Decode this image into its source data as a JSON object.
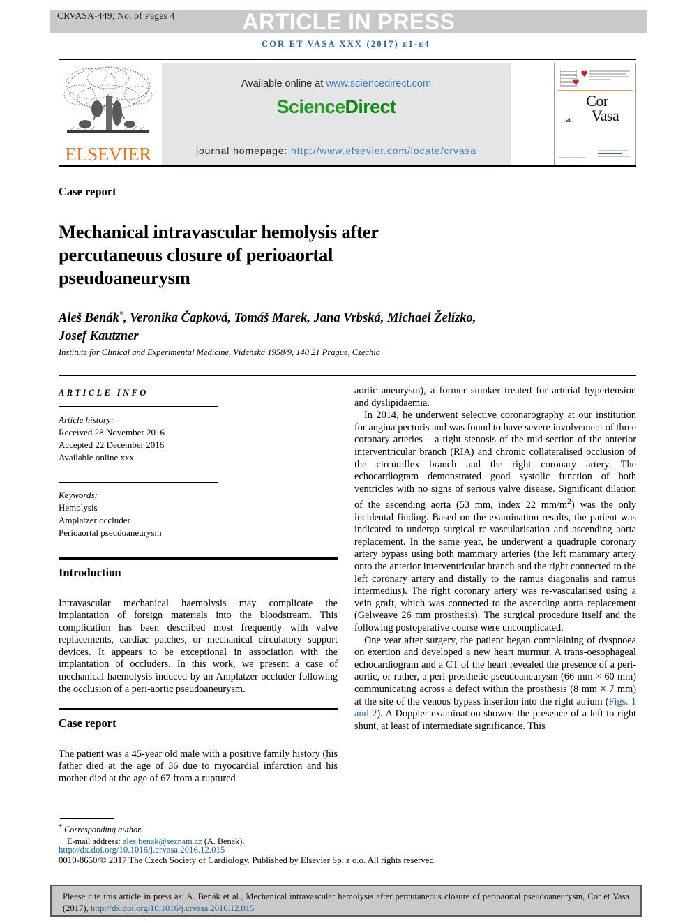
{
  "header": {
    "article_id": "CRVASA-449; No. of Pages 4",
    "article_in_press": "ARTICLE IN PRESS",
    "running_head": "COR ET VASA XXX (2017) e1-e4"
  },
  "masthead": {
    "publisher_name": "ELSEVIER",
    "available_prefix": "Available online at ",
    "available_url": "www.sciencedirect.com",
    "sciencedirect_part1": "Science",
    "sciencedirect_part2": "Direct",
    "homepage_label": "journal homepage: ",
    "homepage_url": "http://www.elsevier.com/locate/crvasa",
    "cover_title_cor": "Cor",
    "cover_title_et": "et",
    "cover_title_vasa": "Vasa"
  },
  "article": {
    "section_label": "Case report",
    "title": "Mechanical intravascular hemolysis after percutaneous closure of perioaortal pseudoaneurysm",
    "authors_line1": "Aleš Benák",
    "authors_line1_rest": ", Veronika Čapková, Tomáš Marek, Jana Vrbská,",
    "authors_line2": "Michael Želízko, Josef Kautzner",
    "corresponding_marker": "*",
    "affiliation": "Institute for Clinical and Experimental Medicine, Vídeňská 1958/9, 140 21 Prague, Czechia"
  },
  "article_info": {
    "heading": "ARTICLE INFO",
    "history_label": "Article history:",
    "received": "Received 28 November 2016",
    "accepted": "Accepted 22 December 2016",
    "available_online": "Available online xxx",
    "keywords_label": "Keywords:",
    "keywords": [
      "Hemolysis",
      "Amplatzer occluder",
      "Perioaortal pseudoaneurysm"
    ]
  },
  "sections": {
    "introduction_heading": "Introduction",
    "introduction_text": "Intravascular mechanical haemolysis may complicate the implantation of foreign materials into the bloodstream. This complication has been described most frequently with valve replacements, cardiac patches, or mechanical circulatory support devices. It appears to be exceptional in association with the implantation of occluders. In this work, we present a case of mechanical haemolysis induced by an Amplatzer occluder following the occlusion of a peri-aortic pseudoaneurysm.",
    "case_report_heading": "Case report",
    "case_report_text": "The patient was a 45-year old male with a positive family history (his father died at the age of 36 due to myocardial infarction and his mother died at the age of 67 from a ruptured"
  },
  "right_column": {
    "para1_continued": "aortic aneurysm), a former smoker treated for arterial hypertension and dyslipidaemia.",
    "para2_a": "In 2014, he underwent selective coronarography at our institution for angina pectoris and was found to have severe involvement of three coronary arteries – a tight stenosis of the mid-section of the anterior interventricular branch (RIA) and chronic collateralised occlusion of the circumflex branch and the right coronary artery. The echocardiogram demonstrated good systolic function of both ventricles with no signs of serious valve disease. Significant dilation of the ascending aorta (53 mm, index 22 mm/m",
    "para2_sup": "2",
    "para2_b": ") was the only incidental finding. Based on the examination results, the patient was indicated to undergo surgical re-vascularisation and ascending aorta replacement. In the same year, he underwent a quadruple coronary artery bypass using both mammary arteries (the left mammary artery onto the anterior interventricular branch and the right connected to the left coronary artery and distally to the ramus diagonalis and ramus intermedius). The right coronary artery was re-vascularised using a vein graft, which was connected to the ascending aorta replacement (Gelweave 26 mm prosthesis). The surgical procedure itself and the following postoperative course were uncomplicated.",
    "para3_a": "One year after surgery, the patient began complaining of dyspnoea on exertion and developed a new heart murmur. A trans-oesophageal echocardiogram and a CT of the heart revealed the presence of a peri-aortic, or rather, a peri-prosthetic pseudoaneurysm (66 mm × 60 mm) communicating across a defect within the prosthesis (8 mm × 7 mm) at the site of the venous bypass insertion into the right atrium (",
    "para3_figlink": "Figs. 1 and 2",
    "para3_b": "). A Doppler examination showed the presence of a left to right shunt, at least of intermediate significance. This"
  },
  "footnote": {
    "corresponding_author": "Corresponding author.",
    "email_label": "E-mail address: ",
    "email": "ales.benak@seznam.cz",
    "email_suffix": " (A. Benák).",
    "doi": "http://dx.doi.org/10.1016/j.crvasa.2016.12.015",
    "copyright": "0010-8650/© 2017 The Czech Society of Cardiology. Published by Elsevier Sp. z o.o. All rights reserved."
  },
  "cite_box": {
    "text_before": "Please cite this article in press as: A. Benák et al., Mechanical intravascular hemolysis after percutaneous closure of perioaortal pseudoaneurysm, Cor et Vasa (2017), ",
    "link": "http://dx.doi.org/10.1016/j.crvasa.2016.12.015"
  },
  "colors": {
    "journal_blue": "#1a6496",
    "link_blue": "#3b7cb8",
    "elsevier_orange": "#e87722",
    "sciencedirect_green": "#1f9c1f",
    "bar_grey": "#c9c9c9",
    "panel_grey": "#e4e5e7"
  }
}
